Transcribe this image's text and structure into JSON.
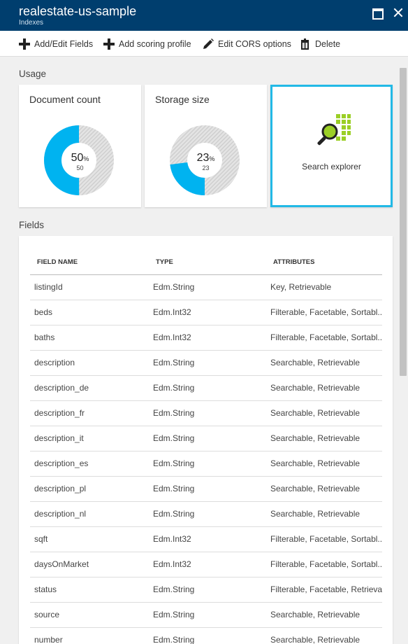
{
  "header": {
    "title": "realestate-us-sample",
    "subtitle": "Indexes"
  },
  "toolbar": {
    "items": [
      {
        "label": "Add/Edit Fields",
        "icon": "plus-icon"
      },
      {
        "label": "Add scoring profile",
        "icon": "plus-icon"
      },
      {
        "label": "Edit CORS options",
        "icon": "pencil-icon"
      },
      {
        "label": "Delete",
        "icon": "trash-icon"
      }
    ]
  },
  "usage": {
    "label": "Usage",
    "document_count": {
      "title": "Document count",
      "percent": 50,
      "percent_label": "50",
      "percent_sign": "%",
      "value": "50"
    },
    "storage_size": {
      "title": "Storage size",
      "percent": 23,
      "percent_label": "23",
      "percent_sign": "%",
      "value": "23"
    },
    "search_explorer": {
      "label": "Search explorer",
      "icon": "search-explorer-icon"
    }
  },
  "colors": {
    "accent": "#22b9e6",
    "titlebar": "#003e6e",
    "icon_green": "#9bcf26"
  },
  "fields": {
    "label": "Fields",
    "columns": [
      "FIELD NAME",
      "TYPE",
      "ATTRIBUTES"
    ],
    "rows": [
      [
        "listingId",
        "Edm.String",
        "Key, Retrievable"
      ],
      [
        "beds",
        "Edm.Int32",
        "Filterable, Facetable, Sortabl..."
      ],
      [
        "baths",
        "Edm.Int32",
        "Filterable, Facetable, Sortabl..."
      ],
      [
        "description",
        "Edm.String",
        "Searchable, Retrievable"
      ],
      [
        "description_de",
        "Edm.String",
        "Searchable, Retrievable"
      ],
      [
        "description_fr",
        "Edm.String",
        "Searchable, Retrievable"
      ],
      [
        "description_it",
        "Edm.String",
        "Searchable, Retrievable"
      ],
      [
        "description_es",
        "Edm.String",
        "Searchable, Retrievable"
      ],
      [
        "description_pl",
        "Edm.String",
        "Searchable, Retrievable"
      ],
      [
        "description_nl",
        "Edm.String",
        "Searchable, Retrievable"
      ],
      [
        "sqft",
        "Edm.Int32",
        "Filterable, Facetable, Sortabl..."
      ],
      [
        "daysOnMarket",
        "Edm.Int32",
        "Filterable, Facetable, Sortabl..."
      ],
      [
        "status",
        "Edm.String",
        "Filterable, Facetable, Retrieva..."
      ],
      [
        "source",
        "Edm.String",
        "Searchable, Retrievable"
      ],
      [
        "number",
        "Edm.String",
        "Searchable, Retrievable"
      ]
    ]
  }
}
